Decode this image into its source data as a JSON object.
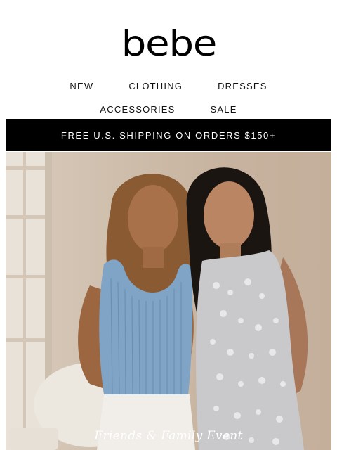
{
  "brand": {
    "logo_text": "bebe"
  },
  "nav": {
    "row1": [
      "NEW",
      "CLOTHING",
      "DRESSES"
    ],
    "row2": [
      "ACCESSORIES",
      "SALE"
    ]
  },
  "promo": {
    "text": "FREE U.S. SHIPPING ON ORDERS $150+"
  },
  "hero": {
    "caption": "Friends & Family Event",
    "image_description": "two women posing, one in blue knit tank and white trousers, one in silver sequin dress"
  },
  "colors": {
    "promo_bg": "#000000",
    "promo_text": "#ffffff",
    "logo": "#000000"
  }
}
